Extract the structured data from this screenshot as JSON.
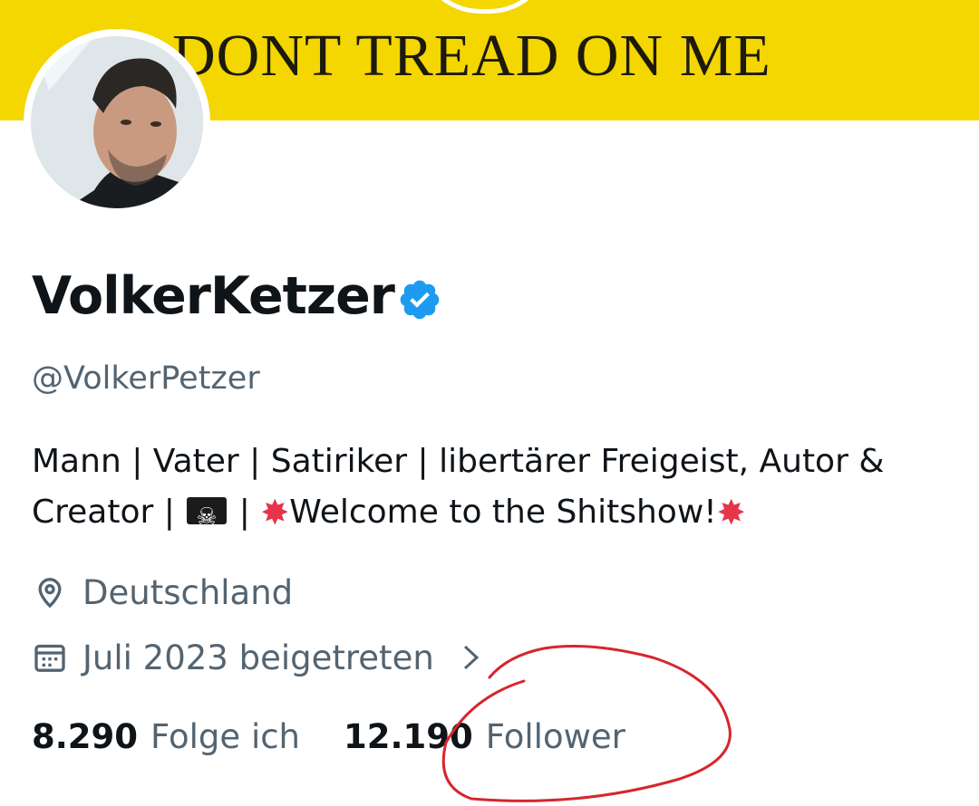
{
  "banner": {
    "text": "DONT TREAD ON ME",
    "color": "#f4d600"
  },
  "profile": {
    "display_name": "VolkerKetzer",
    "verified_icon": "verified-badge-icon",
    "handle": "@VolkerPetzer",
    "bio_line1": "Mann | Vater | Satiriker | libertärer Freigeist, Autor &",
    "bio_line2_start": "Creator |",
    "bio_line2_sep": "|",
    "bio_line2_text": "Welcome to the Shitshow!",
    "location": "Deutschland",
    "joined": "Juli 2023 beigetreten"
  },
  "stats": {
    "following_count": "8.290",
    "following_label": "Folge ich",
    "followers_count": "12.190",
    "followers_label": "Follower"
  },
  "colors": {
    "text": "#0f1419",
    "muted": "#536471",
    "verified": "#1d9bf0",
    "annotation": "#d6262d"
  }
}
